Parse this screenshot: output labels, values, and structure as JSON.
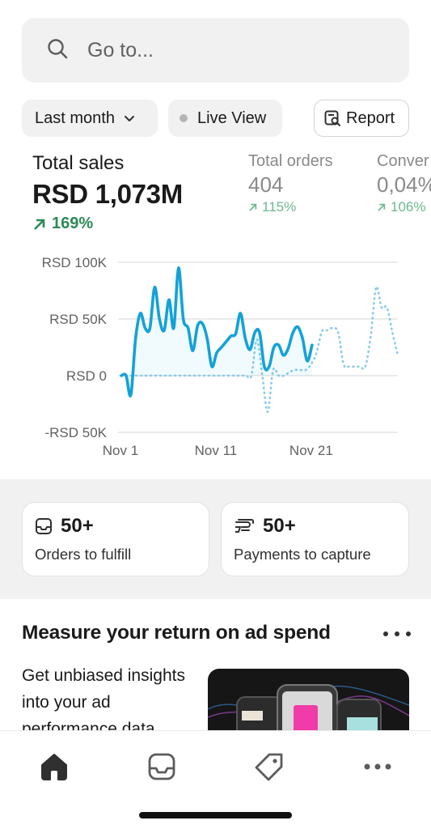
{
  "search": {
    "placeholder": "Go to..."
  },
  "filters": {
    "date_range": "Last month",
    "live_view": "Live View",
    "report": "Report"
  },
  "metrics": [
    {
      "label": "Total sales",
      "value": "RSD 1,073M",
      "change": "169%"
    },
    {
      "label": "Total orders",
      "value": "404",
      "change": "115%"
    },
    {
      "label": "Conver",
      "value": "0,04%",
      "change": "106%"
    }
  ],
  "chart_data": {
    "type": "line",
    "x_tick_labels": [
      "Nov 1",
      "Nov 11",
      "Nov 21"
    ],
    "y_tick_labels": [
      "RSD 100K",
      "RSD 50K",
      "RSD 0",
      "-RSD 50K"
    ],
    "ylim": [
      -50000,
      100000
    ],
    "x": [
      0,
      0.5,
      1,
      1.5,
      2,
      2.5,
      3,
      3.5,
      4,
      4.5,
      5,
      5.5,
      6,
      6.5,
      7,
      7.5,
      8,
      8.5,
      9,
      9.5,
      10,
      10.5,
      11,
      11.5,
      12,
      12.5,
      13,
      13.5,
      14,
      14.5,
      15,
      15.5,
      16,
      16.5,
      17,
      17.5,
      18,
      18.5,
      19,
      19.5,
      20,
      20.5,
      21,
      21.5,
      22,
      22.5,
      23,
      23.5,
      24,
      24.5,
      25,
      25.5,
      26,
      26.5,
      27,
      27.5,
      28,
      28.5,
      29
    ],
    "series": [
      {
        "style": "solid",
        "color": "#13a2d8",
        "values": [
          0,
          0,
          -17000,
          33000,
          55000,
          42000,
          42000,
          78000,
          50000,
          40000,
          67000,
          42000,
          95000,
          50000,
          42000,
          22000,
          44000,
          46000,
          33000,
          8000,
          20000,
          25000,
          30000,
          35000,
          37000,
          55000,
          33000,
          23000,
          38000,
          38000,
          8000,
          8000,
          25000,
          27000,
          18000,
          24000,
          38000,
          43000,
          33000,
          13000,
          27000
        ]
      },
      {
        "style": "dotted",
        "color": "#8ccbe8",
        "values": [
          0,
          0,
          0,
          0,
          0,
          0,
          0,
          0,
          0,
          0,
          0,
          0,
          0,
          0,
          0,
          0,
          0,
          0,
          0,
          0,
          0,
          0,
          0,
          0,
          0,
          32000,
          0,
          -32000,
          5000,
          0,
          0,
          3000,
          5000,
          5000,
          5000,
          10000,
          20000,
          39000,
          40000,
          42000,
          38000,
          10000,
          8000,
          8000,
          8000,
          8000,
          35000,
          78000,
          60000,
          60000,
          38000,
          18000
        ]
      }
    ]
  },
  "cards": [
    {
      "count": "50+",
      "label": "Orders to fulfill",
      "icon": "inbox-icon"
    },
    {
      "count": "50+",
      "label": "Payments to capture",
      "icon": "cash-icon"
    }
  ],
  "promo": {
    "title": "Measure your return on ad spend",
    "body": "Get unbiased insights into your ad performance data"
  },
  "tabs": [
    "home-icon",
    "orders-icon",
    "products-icon",
    "more-icon"
  ],
  "colors": {
    "accent": "#13a2d8",
    "positive": "#2b8a57",
    "muted_positive": "#6fb892"
  }
}
